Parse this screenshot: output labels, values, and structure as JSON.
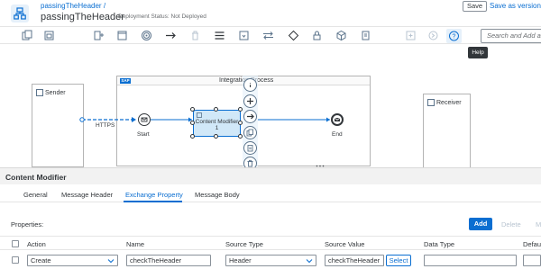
{
  "header": {
    "breadcrumb": "passingTheHeader /",
    "title": "passingTheHeader",
    "deployment_status": "Deployment Status: Not Deployed",
    "save_label": "Save",
    "save_as_label": "Save as version"
  },
  "toolbar": {
    "search_placeholder": "Search and Add a",
    "help_tooltip": "Help"
  },
  "canvas": {
    "sender_label": "Sender",
    "receiver_label": "Receiver",
    "process_title": "Integration Process",
    "sap_logo": "SAP",
    "adapter_label": "HTTPS",
    "start_label": "Start",
    "end_label": "End",
    "step_label": "Content Modifier",
    "step_number": "1"
  },
  "panel": {
    "title": "Content Modifier",
    "tabs": [
      {
        "label": "General"
      },
      {
        "label": "Message Header"
      },
      {
        "label": "Exchange Property"
      },
      {
        "label": "Message Body"
      }
    ],
    "active_tab": "Exchange Property",
    "properties_label": "Properties:",
    "add_label": "Add",
    "delete_label": "Delete",
    "more_label": "M",
    "columns": {
      "action": "Action",
      "name": "Name",
      "source_type": "Source Type",
      "source_value": "Source Value",
      "data_type": "Data Type",
      "default": "Defau"
    },
    "rows": [
      {
        "action": "Create",
        "name": "checkTheHeader",
        "source_type": "Header",
        "source_value": "checkTheHeader",
        "select_label": "Select",
        "data_type": "",
        "default": ""
      }
    ]
  },
  "colors": {
    "accent": "#0a6ed1",
    "step_fill": "#d1e8f8"
  }
}
